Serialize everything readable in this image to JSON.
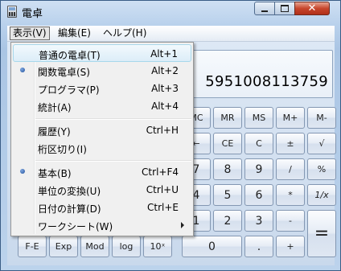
{
  "window": {
    "title": "電卓"
  },
  "menubar": {
    "items": [
      "表示(V)",
      "編集(E)",
      "ヘルプ(H)"
    ]
  },
  "display": {
    "value": "5951008113759"
  },
  "view_menu": {
    "items": [
      {
        "label": "普通の電卓(T)",
        "shortcut": "Alt+1",
        "checked": false,
        "highlighted": true
      },
      {
        "label": "関数電卓(S)",
        "shortcut": "Alt+2",
        "checked": true,
        "highlighted": false
      },
      {
        "label": "プログラマ(P)",
        "shortcut": "Alt+3",
        "checked": false,
        "highlighted": false
      },
      {
        "label": "統計(A)",
        "shortcut": "Alt+4",
        "checked": false,
        "highlighted": false
      },
      {
        "label": "履歴(Y)",
        "shortcut": "Ctrl+H",
        "checked": false,
        "highlighted": false
      },
      {
        "label": "桁区切り(I)",
        "shortcut": "",
        "checked": false,
        "highlighted": false
      },
      {
        "label": "基本(B)",
        "shortcut": "Ctrl+F4",
        "checked": true,
        "highlighted": false
      },
      {
        "label": "単位の変換(U)",
        "shortcut": "Ctrl+U",
        "checked": false,
        "highlighted": false
      },
      {
        "label": "日付の計算(D)",
        "shortcut": "Ctrl+E",
        "checked": false,
        "highlighted": false
      },
      {
        "label": "ワークシート(W)",
        "shortcut": "",
        "checked": false,
        "highlighted": false,
        "submenu": true
      }
    ]
  },
  "keys": {
    "MC": "MC",
    "MR": "MR",
    "MS": "MS",
    "Mplus": "M+",
    "Mminus": "M-",
    "back": "←",
    "CE": "CE",
    "C": "C",
    "plusminus": "±",
    "sqrt": "√",
    "seven": "7",
    "eight": "8",
    "nine": "9",
    "divide": "/",
    "percent": "%",
    "four": "4",
    "five": "5",
    "six": "6",
    "multiply": "*",
    "reciprocal": "1/x",
    "one": "1",
    "two": "2",
    "three": "3",
    "minus": "-",
    "equals": "=",
    "zero": "0",
    "dot": ".",
    "plus": "+",
    "FE": "F-E",
    "Exp": "Exp",
    "Mod": "Mod",
    "log": "log",
    "tenx": "10ˣ"
  }
}
